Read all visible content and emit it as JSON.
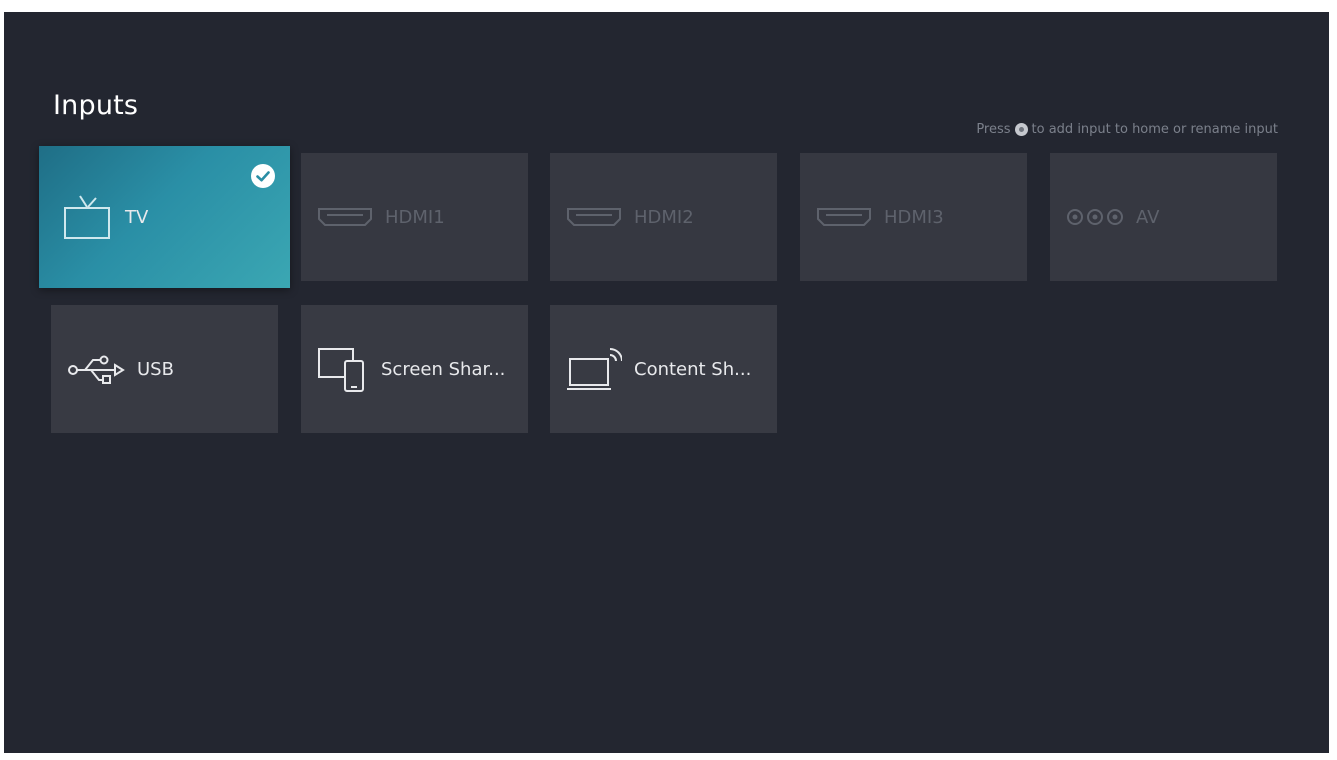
{
  "header": {
    "title": "Inputs",
    "hint_prefix": "Press",
    "hint_suffix": "to add input to home or rename input"
  },
  "inputs": [
    {
      "label": "TV",
      "icon": "tv-icon",
      "state": "selected",
      "checked": true
    },
    {
      "label": "HDMI1",
      "icon": "hdmi-icon",
      "state": "disabled"
    },
    {
      "label": "HDMI2",
      "icon": "hdmi-icon",
      "state": "disabled"
    },
    {
      "label": "HDMI3",
      "icon": "hdmi-icon",
      "state": "disabled"
    },
    {
      "label": "AV",
      "icon": "av-connector-icon",
      "state": "disabled"
    },
    {
      "label": "USB",
      "icon": "usb-icon",
      "state": "enabled"
    },
    {
      "label": "Screen Shar...",
      "icon": "screen-share-icon",
      "state": "enabled"
    },
    {
      "label": "Content Sh...",
      "icon": "content-share-icon",
      "state": "enabled"
    }
  ],
  "colors": {
    "background": "#232630",
    "tile": "#383a43",
    "selected_start": "#1f6e86",
    "selected_end": "#3ba7b3",
    "disabled_text": "#5e626c"
  }
}
